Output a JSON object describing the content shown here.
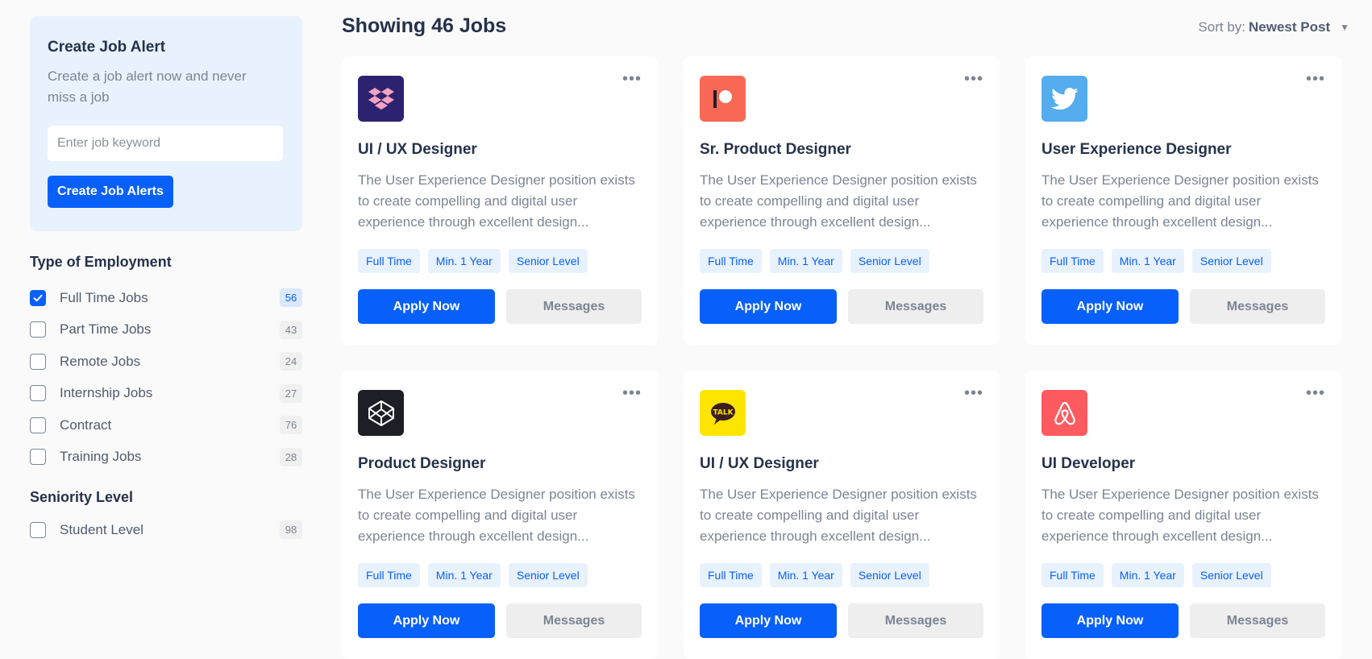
{
  "sidebar": {
    "alert": {
      "title": "Create Job Alert",
      "subtitle": "Create a job alert now and never miss a job",
      "input_placeholder": "Enter job keyword",
      "button_label": "Create Job Alerts"
    },
    "employment": {
      "title": "Type of Employment",
      "items": [
        {
          "label": "Full Time Jobs",
          "count": "56",
          "checked": true
        },
        {
          "label": "Part Time Jobs",
          "count": "43",
          "checked": false
        },
        {
          "label": "Remote Jobs",
          "count": "24",
          "checked": false
        },
        {
          "label": "Internship Jobs",
          "count": "27",
          "checked": false
        },
        {
          "label": "Contract",
          "count": "76",
          "checked": false
        },
        {
          "label": "Training Jobs",
          "count": "28",
          "checked": false
        }
      ]
    },
    "seniority": {
      "title": "Seniority Level",
      "items": [
        {
          "label": "Student Level",
          "count": "98",
          "checked": false
        }
      ]
    }
  },
  "main": {
    "showing": "Showing 46 Jobs",
    "sort_label": "Sort by:",
    "sort_value": "Newest Post",
    "jobs": [
      {
        "logo": "dropbox-icon",
        "logo_bg": "#2d2270",
        "title": "UI / UX Designer",
        "desc": "The User Experience Designer position exists to create compelling and digital user experience through excellent design...",
        "tags": [
          "Full Time",
          "Min. 1 Year",
          "Senior Level"
        ],
        "apply": "Apply Now",
        "messages": "Messages"
      },
      {
        "logo": "patreon-icon",
        "logo_bg": "#f96854",
        "title": "Sr. Product Designer",
        "desc": "The User Experience Designer position exists to create compelling and digital user experience through excellent design...",
        "tags": [
          "Full Time",
          "Min. 1 Year",
          "Senior Level"
        ],
        "apply": "Apply Now",
        "messages": "Messages"
      },
      {
        "logo": "twitter-icon",
        "logo_bg": "#55acee",
        "title": "User Experience Designer",
        "desc": "The User Experience Designer position exists to create compelling and digital user experience through excellent design...",
        "tags": [
          "Full Time",
          "Min. 1 Year",
          "Senior Level"
        ],
        "apply": "Apply Now",
        "messages": "Messages"
      },
      {
        "logo": "codepen-icon",
        "logo_bg": "#1e1f26",
        "title": "Product Designer",
        "desc": "The User Experience Designer position exists to create compelling and digital user experience through excellent design...",
        "tags": [
          "Full Time",
          "Min. 1 Year",
          "Senior Level"
        ],
        "apply": "Apply Now",
        "messages": "Messages"
      },
      {
        "logo": "kakaotalk-icon",
        "logo_bg": "#fee500",
        "title": "UI / UX Designer",
        "desc": "The User Experience Designer position exists to create compelling and digital user experience through excellent design...",
        "tags": [
          "Full Time",
          "Min. 1 Year",
          "Senior Level"
        ],
        "apply": "Apply Now",
        "messages": "Messages"
      },
      {
        "logo": "airbnb-icon",
        "logo_bg": "#ff5a5f",
        "title": "UI Developer",
        "desc": "The User Experience Designer position exists to create compelling and digital user experience through excellent design...",
        "tags": [
          "Full Time",
          "Min. 1 Year",
          "Senior Level"
        ],
        "apply": "Apply Now",
        "messages": "Messages"
      }
    ]
  },
  "colors": {
    "accent": "#0860fb",
    "alert_bg": "#e8f2fe",
    "tag_bg": "#e8f2fe",
    "text_dark": "#25324b",
    "text_muted": "#7c8493"
  }
}
